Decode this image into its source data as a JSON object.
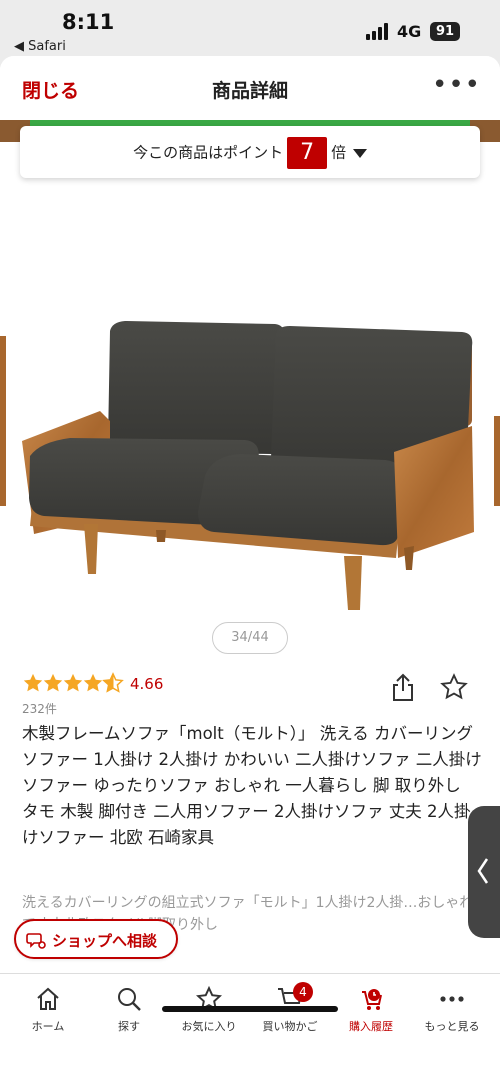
{
  "status": {
    "time": "8:11",
    "back_app": "◀ Safari",
    "network": "4G",
    "battery": "91"
  },
  "nav": {
    "close": "閉じる",
    "title": "商品詳細"
  },
  "points": {
    "prefix": "今この商品はポイント",
    "multiplier": "7",
    "suffix": "倍"
  },
  "gallery": {
    "pager": "34/44"
  },
  "rating": {
    "value": "4.66",
    "fraction": 0.932,
    "reviews": "232件"
  },
  "product": {
    "title": "木製フレームソファ「molt（モルト）」 洗える カバーリング ソファー 1人掛け 2人掛け かわいい 二人掛けソファ 二人掛けソファー ゆったりソファ おしゃれ 一人暮らし 脚 取り外し タモ 木製 脚付き 二人用ソファー 2人掛けソファ 丈夫 2人掛けソファー 北欧 石崎家具",
    "desc": "洗えるカバーリングの組立式ソファ「モルト」1人掛け2人掛…おしゃれで丈夫北欧スタイル脚取り外し"
  },
  "shop_button": "ショップへ相談",
  "tabs": [
    {
      "label": "ホーム",
      "icon": "home-icon"
    },
    {
      "label": "探す",
      "icon": "search-icon"
    },
    {
      "label": "お気に入り",
      "icon": "star-icon"
    },
    {
      "label": "買い物かご",
      "icon": "cart-icon",
      "badge": "4"
    },
    {
      "label": "購入履歴",
      "icon": "purchase-history-icon"
    },
    {
      "label": "もっと見る",
      "icon": "more-icon"
    }
  ],
  "colors": {
    "accent": "#bf0000",
    "star": "#f5a623"
  }
}
